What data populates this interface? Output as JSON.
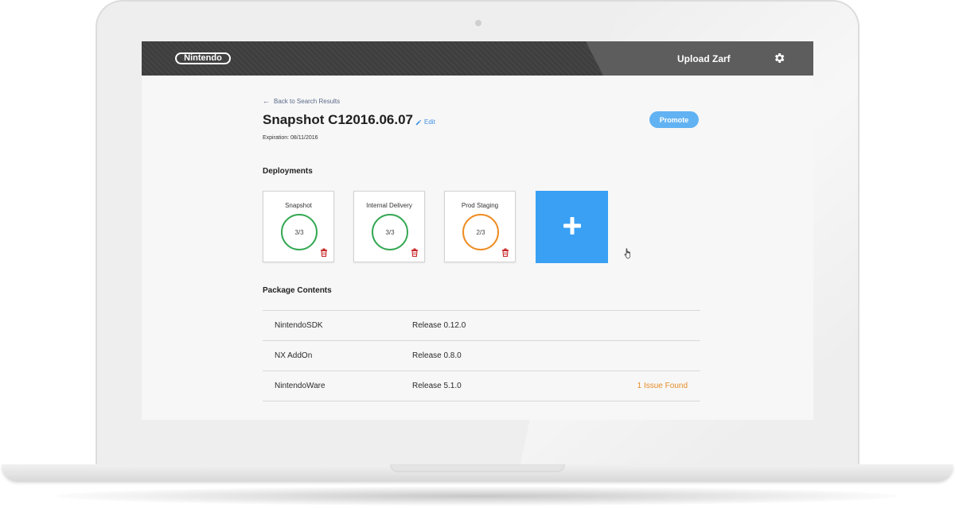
{
  "brand": {
    "logo_text": "Nintendo"
  },
  "header": {
    "upload_label": "Upload Zarf",
    "settings_icon": "gear-icon"
  },
  "nav": {
    "back_label": "Back to Search Results"
  },
  "snapshot": {
    "title": "Snapshot C12016.06.07",
    "edit_label": "Edit",
    "expiration": "Expiration: 08/11/2016",
    "promote_label": "Promote"
  },
  "deployments": {
    "heading": "Deployments",
    "cards": [
      {
        "name": "Snapshot",
        "status": "3/3",
        "color": "#34a853"
      },
      {
        "name": "Internal Delivery",
        "status": "3/3",
        "color": "#34a853"
      },
      {
        "name": "Prod Staging",
        "status": "2/3",
        "color": "#ef8c22"
      }
    ],
    "add_icon": "plus-icon"
  },
  "packages": {
    "heading": "Package Contents",
    "rows": [
      {
        "name": "NintendoSDK",
        "version": "Release 0.12.0",
        "issue": ""
      },
      {
        "name": "NX AddOn",
        "version": "Release 0.8.0",
        "issue": ""
      },
      {
        "name": "NintendoWare",
        "version": "Release 5.1.0",
        "issue": "1 Issue Found"
      }
    ]
  },
  "colors": {
    "accent": "#39a0f4",
    "promote": "#61b2f2",
    "success": "#34a853",
    "warning": "#ef8c22",
    "danger": "#c62828"
  }
}
